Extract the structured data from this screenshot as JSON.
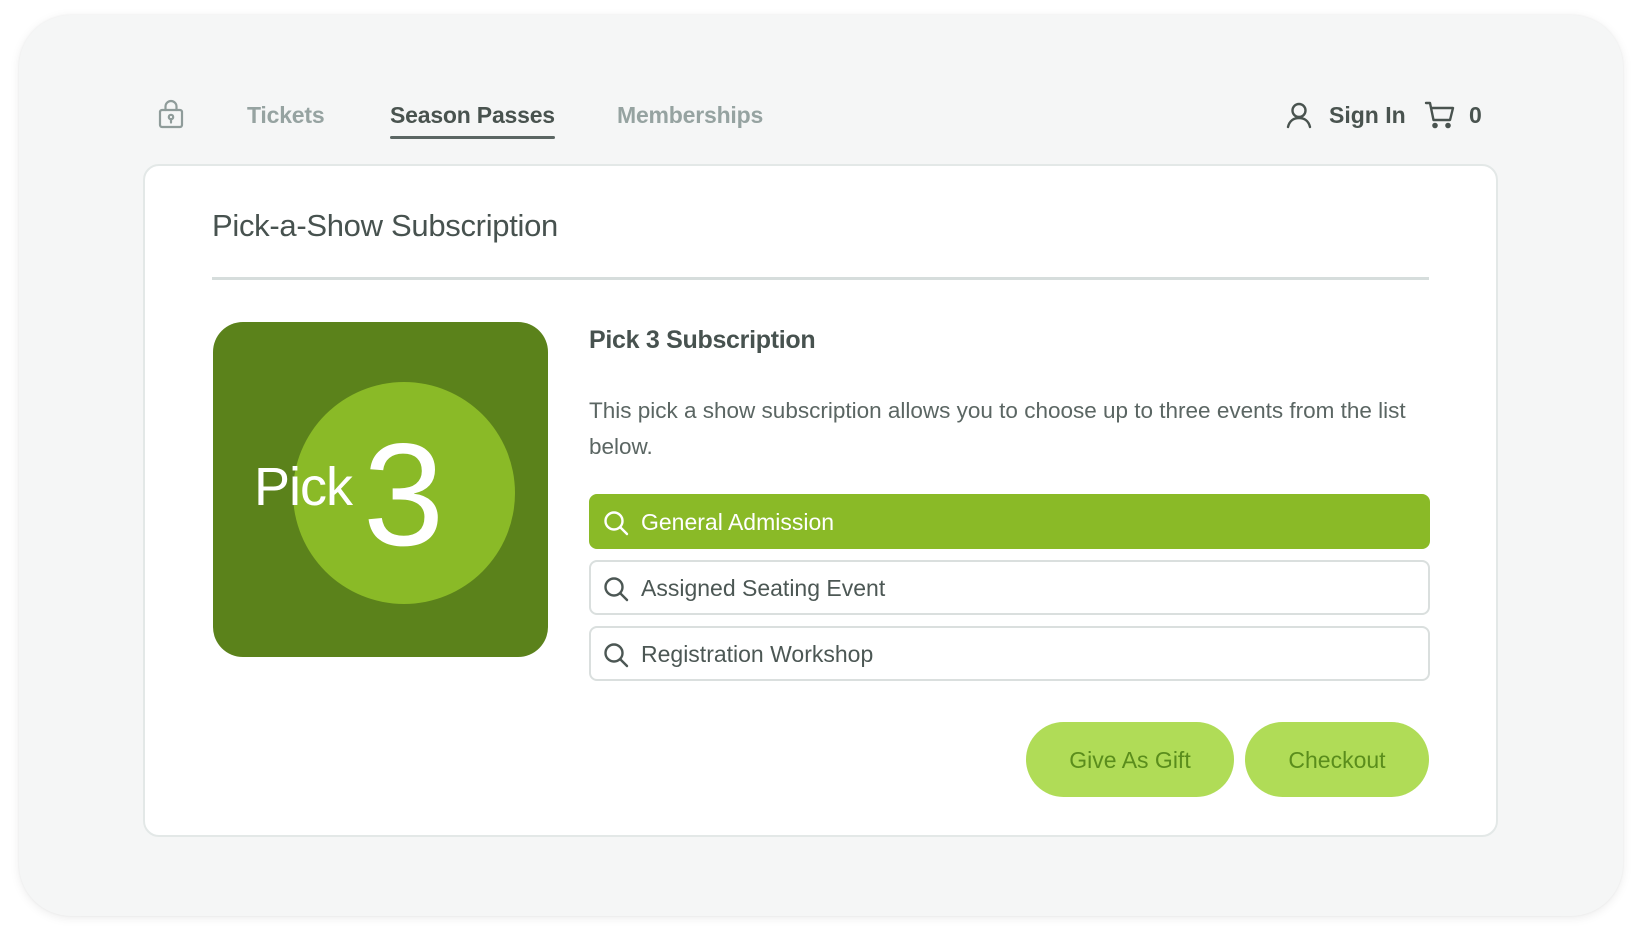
{
  "nav": {
    "lock_icon": "lock-icon",
    "tabs": [
      {
        "label": "Tickets",
        "active": false
      },
      {
        "label": "Season Passes",
        "active": true
      },
      {
        "label": "Memberships",
        "active": false
      }
    ],
    "user_icon": "user-icon",
    "sign_in": "Sign In",
    "cart_icon": "shopping-cart-icon",
    "cart_count": "0"
  },
  "page": {
    "title": "Pick-a-Show Subscription"
  },
  "product": {
    "image": {
      "pick_text": "Pick",
      "number": "3"
    },
    "title": "Pick 3 Subscription",
    "description": "This pick a show subscription allows you to choose up to three events from the list below.",
    "events": [
      {
        "label": "General Admission",
        "selected": true,
        "icon": "search-icon"
      },
      {
        "label": "Assigned Seating Event",
        "selected": false,
        "icon": "search-icon"
      },
      {
        "label": "Registration Workshop",
        "selected": false,
        "icon": "search-icon"
      }
    ]
  },
  "actions": {
    "gift_label": "Give As Gift",
    "checkout_label": "Checkout"
  },
  "colors": {
    "brand_dark_green": "#5b821b",
    "brand_green": "#8aba27",
    "button_light_green": "#b0dc57",
    "button_text_green": "#5a8d1c",
    "text_dark": "#47524f",
    "text_muted": "#96a3a1"
  }
}
